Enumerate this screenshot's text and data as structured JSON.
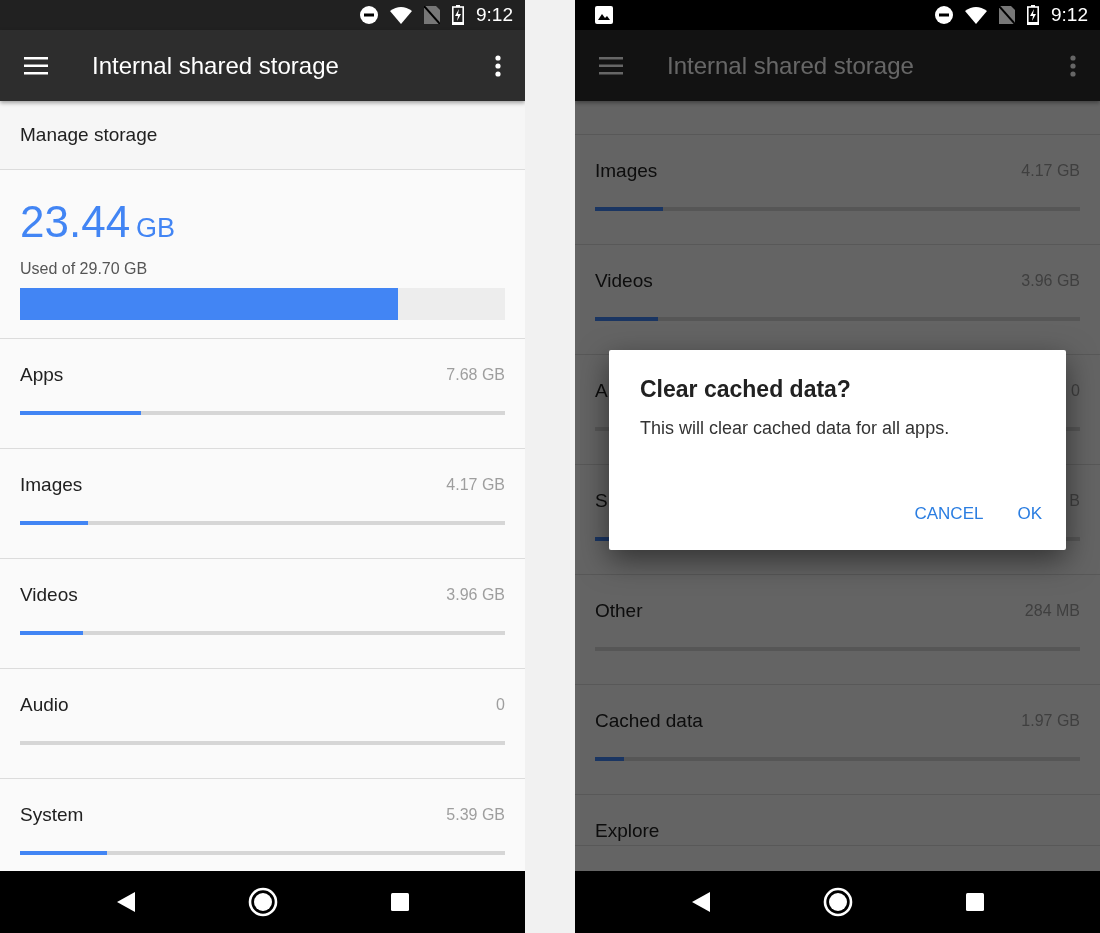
{
  "screens": [
    {
      "dimmed": false,
      "image_notification": false,
      "status_bar": {
        "time": "9:12"
      },
      "toolbar": {
        "title": "Internal shared storage"
      },
      "manage_storage": "Manage storage",
      "summary": {
        "amount": "23.44",
        "unit": "GB",
        "caption": "Used of 29.70 GB",
        "level": 0.78
      },
      "categories": [
        {
          "kind": "category",
          "label": "Apps",
          "value": "7.68 GB",
          "level": 0.25
        },
        {
          "kind": "category",
          "label": "Images",
          "value": "4.17 GB",
          "level": 0.14
        },
        {
          "kind": "category",
          "label": "Videos",
          "value": "3.96 GB",
          "level": 0.13
        },
        {
          "kind": "category",
          "label": "Audio",
          "value": "0",
          "level": 0
        },
        {
          "kind": "category",
          "label": "System",
          "value": "5.39 GB",
          "level": 0.18
        }
      ]
    },
    {
      "dimmed": true,
      "image_notification": true,
      "status_bar": {
        "time": "9:12"
      },
      "toolbar": {
        "title": "Internal shared storage"
      },
      "categories": [
        {
          "kind": "category",
          "label": "Images",
          "value": "4.17 GB",
          "level": 0.14
        },
        {
          "kind": "category",
          "label": "Videos",
          "value": "3.96 GB",
          "level": 0.13
        },
        {
          "kind": "category",
          "label": "A",
          "value": "0",
          "level": 0
        },
        {
          "kind": "category",
          "label": "S",
          "value": "B",
          "level": 0.03
        },
        {
          "kind": "category",
          "label": "Other",
          "value": "284 MB",
          "level": 0
        },
        {
          "kind": "category",
          "label": "Cached data",
          "value": "1.97 GB",
          "level": 0.06
        },
        {
          "kind": "link",
          "label": "Explore"
        }
      ],
      "dialog": {
        "title": "Clear cached data?",
        "message": "This will clear cached data for all apps.",
        "buttons": [
          "CANCEL",
          "OK"
        ]
      }
    }
  ]
}
